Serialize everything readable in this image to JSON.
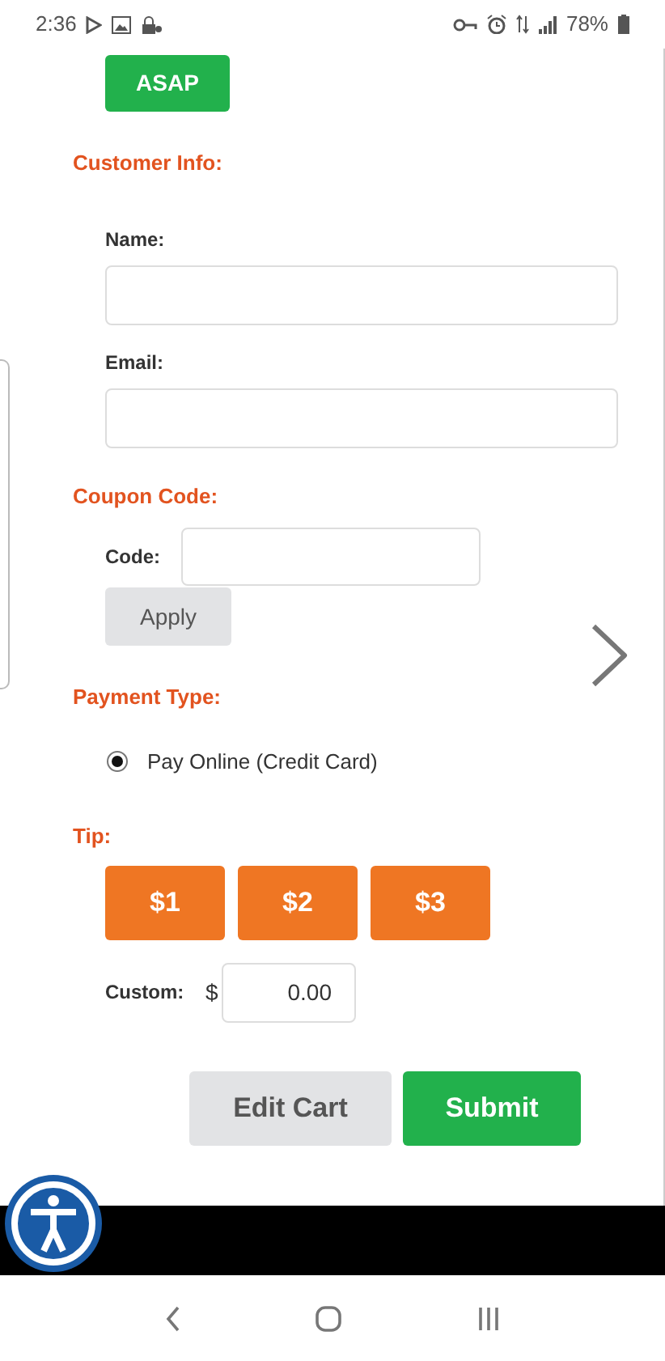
{
  "status_bar": {
    "time": "2:36",
    "battery": "78%"
  },
  "pickup": {
    "button": "ASAP"
  },
  "customer_info": {
    "heading": "Customer Info:",
    "fields": [
      {
        "label": "Name:"
      },
      {
        "label": "Email:"
      }
    ]
  },
  "coupon": {
    "heading": "Coupon Code:",
    "label": "Code:",
    "button": "Apply"
  },
  "payment": {
    "heading": "Payment Type:",
    "options": [
      {
        "label": "Pay Online (Credit Card)",
        "selected": true
      }
    ]
  },
  "tip": {
    "heading": "Tip:",
    "options": [
      {
        "label": "$1"
      },
      {
        "label": "$2"
      },
      {
        "label": "$3"
      }
    ],
    "custom_label": "Custom:",
    "currency": "$",
    "custom_value": "0.00"
  },
  "actions": [
    {
      "label": "Edit Cart",
      "kind": "secondary"
    },
    {
      "label": "Submit",
      "kind": "primary"
    }
  ]
}
